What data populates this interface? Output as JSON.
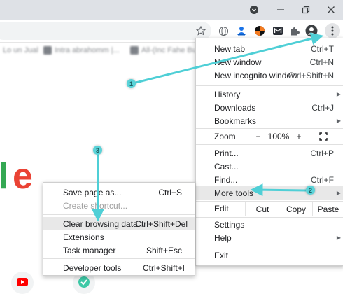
{
  "window": {
    "controls": [
      "minimize-icon",
      "restore-icon",
      "close-icon"
    ]
  },
  "toolbar": {
    "icons": [
      "star-icon",
      "globe-icon",
      "extension-icon",
      "extension-icon",
      "mail-icon",
      "puzzle-icon",
      "avatar-icon",
      "kebab-menu-icon"
    ]
  },
  "bookmarks": {
    "items": [
      "Lo un Jual",
      "Intra abrahomm |...",
      "All-(Inc Fahe Buy..."
    ]
  },
  "main_menu": {
    "items": [
      {
        "label": "New tab",
        "shortcut": "Ctrl+T"
      },
      {
        "label": "New window",
        "shortcut": "Ctrl+N"
      },
      {
        "label": "New incognito window",
        "shortcut": "Ctrl+Shift+N"
      },
      {
        "label": "History",
        "shortcut": ""
      },
      {
        "label": "Downloads",
        "shortcut": "Ctrl+J"
      },
      {
        "label": "Bookmarks",
        "shortcut": ""
      },
      {
        "label": "Print...",
        "shortcut": "Ctrl+P"
      },
      {
        "label": "Cast...",
        "shortcut": ""
      },
      {
        "label": "Find...",
        "shortcut": "Ctrl+F"
      },
      {
        "label": "More tools",
        "shortcut": ""
      },
      {
        "label": "Settings",
        "shortcut": ""
      },
      {
        "label": "Help",
        "shortcut": ""
      },
      {
        "label": "Exit",
        "shortcut": ""
      }
    ],
    "zoom": {
      "label": "Zoom",
      "minus": "−",
      "value": "100%",
      "plus": "+"
    },
    "edit": {
      "label": "Edit",
      "cut": "Cut",
      "copy": "Copy",
      "paste": "Paste"
    }
  },
  "more_tools_menu": {
    "items": [
      {
        "label": "Save page as...",
        "shortcut": "Ctrl+S"
      },
      {
        "label": "Create shortcut...",
        "shortcut": ""
      },
      {
        "label": "Clear browsing data...",
        "shortcut": "Ctrl+Shift+Del"
      },
      {
        "label": "Extensions",
        "shortcut": ""
      },
      {
        "label": "Task manager",
        "shortcut": "Shift+Esc"
      },
      {
        "label": "Developer tools",
        "shortcut": "Ctrl+Shift+I"
      }
    ]
  },
  "page": {
    "logo_letters": [
      "l",
      "e"
    ]
  },
  "callouts": [
    "1",
    "2",
    "3"
  ],
  "colors": {
    "accent_arrow": "#4fcfd6",
    "google_green": "#34a853",
    "google_red": "#ea4335"
  }
}
